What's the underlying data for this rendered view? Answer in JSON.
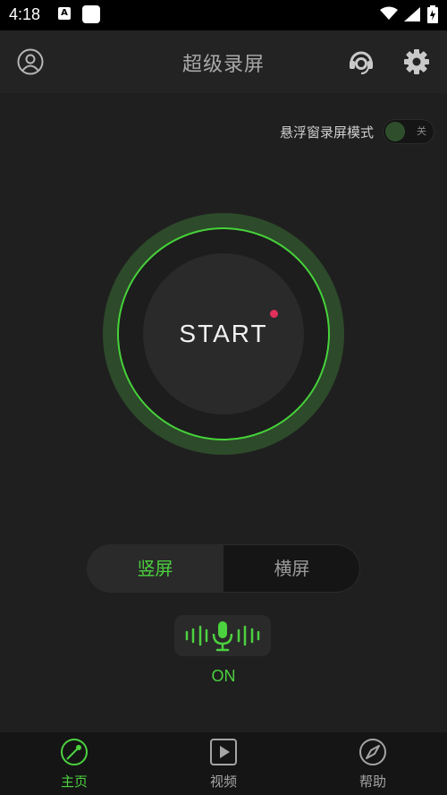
{
  "status_bar": {
    "time": "4:18",
    "icons": [
      "a-notification-icon",
      "app-notification-icon",
      "wifi-icon",
      "signal-icon",
      "battery-icon"
    ]
  },
  "header": {
    "title": "超级录屏",
    "left_icon": "user-avatar-icon",
    "right_icons": [
      "customer-service-icon",
      "gear-icon"
    ]
  },
  "floating_mode": {
    "label": "悬浮窗录屏模式",
    "toggle_text": "关",
    "enabled": false
  },
  "start_button": {
    "label": "START"
  },
  "orientation": {
    "options": [
      "竖屏",
      "横屏"
    ],
    "selected": "竖屏"
  },
  "microphone": {
    "icon": "microphone-icon",
    "state": "ON"
  },
  "bottom_nav": {
    "items": [
      {
        "label": "主页",
        "icon": "home-radar-icon",
        "active": true
      },
      {
        "label": "视频",
        "icon": "video-play-icon",
        "active": false
      },
      {
        "label": "帮助",
        "icon": "compass-icon",
        "active": false
      }
    ]
  },
  "colors": {
    "accent": "#4cd13f",
    "background": "#1f1f1f",
    "ring": "#2d4a2a",
    "record_dot": "#e0305b"
  }
}
